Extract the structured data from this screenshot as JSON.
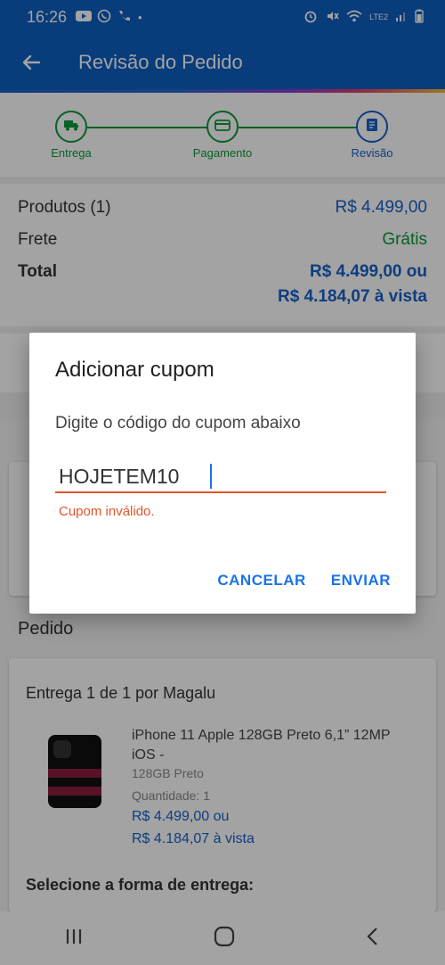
{
  "status_bar": {
    "time": "16:26",
    "left_icons": [
      "youtube-icon",
      "whatsapp-icon",
      "phone-call-icon",
      "dot-icon"
    ],
    "right_text": "LTE2",
    "right_icons": [
      "alarm-icon",
      "mute-icon",
      "wifi-icon",
      "signal-icon",
      "battery-icon"
    ]
  },
  "app_bar": {
    "title": "Revisão do Pedido",
    "back_icon": "arrow-back-icon",
    "bg_color": "#0d5fc0"
  },
  "stepper": {
    "steps": [
      {
        "label": "Entrega",
        "icon": "truck-icon",
        "state": "done"
      },
      {
        "label": "Pagamento",
        "icon": "card-icon",
        "state": "done"
      },
      {
        "label": "Revisão",
        "icon": "document-icon",
        "state": "active"
      }
    ]
  },
  "summary": {
    "products_label": "Produtos (1)",
    "products_value": "R$ 4.499,00",
    "shipping_label": "Frete",
    "shipping_value": "Grátis",
    "total_label": "Total",
    "total_value_1": "R$ 4.499,00 ou",
    "total_value_2": "R$ 4.184,07 à vista"
  },
  "order": {
    "section_title": "Pedido",
    "delivery_heading": "Entrega 1 de 1 por Magalu",
    "product_name": "iPhone 11 Apple 128GB Preto 6,1” 12MP iOS -",
    "product_variant": "128GB Preto",
    "quantity_label": "Quantidade:",
    "quantity_value": "1",
    "price_1": "R$ 4.499,00 ou",
    "price_2": "R$ 4.184,07 à vista",
    "shipping_method_heading": "Selecione a forma de entrega:"
  },
  "dialog": {
    "title": "Adicionar cupom",
    "message": "Digite o código do cupom abaixo",
    "input_value": "HOJETEM10",
    "error": "Cupom inválido.",
    "cancel_label": "CANCELAR",
    "send_label": "ENVIAR",
    "accent_color": "#1a73e8",
    "error_color": "#e2542b"
  },
  "bottom_nav": {
    "icons": [
      "recent-apps-icon",
      "home-icon",
      "back-icon"
    ]
  }
}
